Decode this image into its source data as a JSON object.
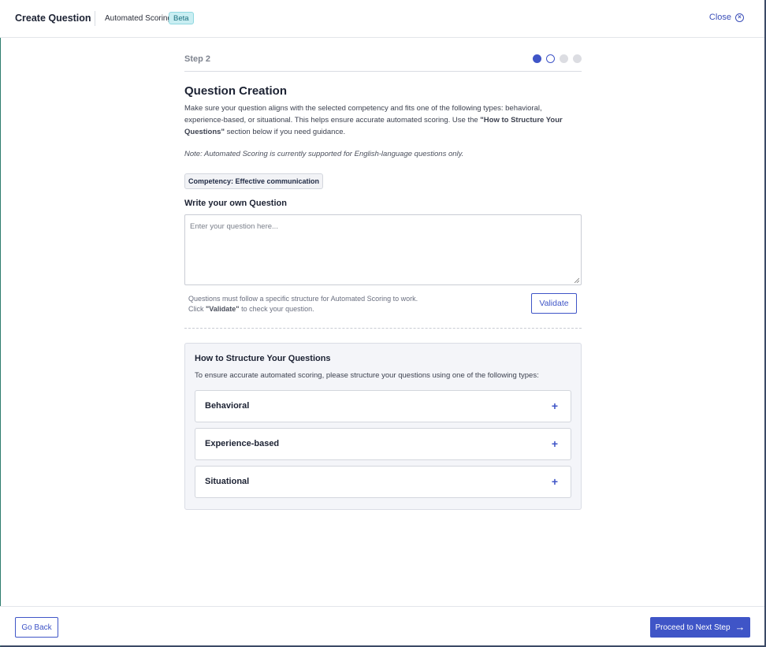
{
  "header": {
    "title": "Create Question",
    "subtitle": "Automated Scoring",
    "badge": "Beta",
    "close_label": "Close",
    "close_icon": "close-circle-icon"
  },
  "step": {
    "label": "Step 2",
    "total": 4,
    "current": 2
  },
  "question": {
    "title": "Question Creation",
    "desc_part1": "Make sure your question aligns with the selected competency and fits one of the following types: behavioral, experience-based, or situational. This helps ensure accurate automated scoring. Use the ",
    "desc_bold": "\"How to Structure Your Questions\"",
    "desc_part2": " section below if you need guidance.",
    "note": "Note: Automated Scoring is currently supported for English-language questions only.",
    "competency": "Competency: Effective communication",
    "write_label": "Write your own Question",
    "placeholder": "Enter your question here...",
    "value": "",
    "hint_line1": "Questions must follow a specific structure for Automated Scoring to work.",
    "hint_line2_pre": "Click ",
    "hint_line2_bold": "\"Validate\"",
    "hint_line2_post": " to check your question.",
    "validate_label": "Validate"
  },
  "structure": {
    "title": "How to Structure Your Questions",
    "subtitle": "To ensure accurate automated scoring, please structure your questions using one of the following types:",
    "items": [
      {
        "label": "Behavioral"
      },
      {
        "label": "Experience-based"
      },
      {
        "label": "Situational"
      }
    ],
    "expand_icon": "plus-icon"
  },
  "footer": {
    "back_label": "Go Back",
    "next_label": "Proceed to Next Step",
    "next_icon": "arrow-right-icon"
  },
  "colors": {
    "accent": "#3f55c7",
    "badge_bg": "#c9eef2",
    "panel_bg": "#f4f5f9"
  }
}
